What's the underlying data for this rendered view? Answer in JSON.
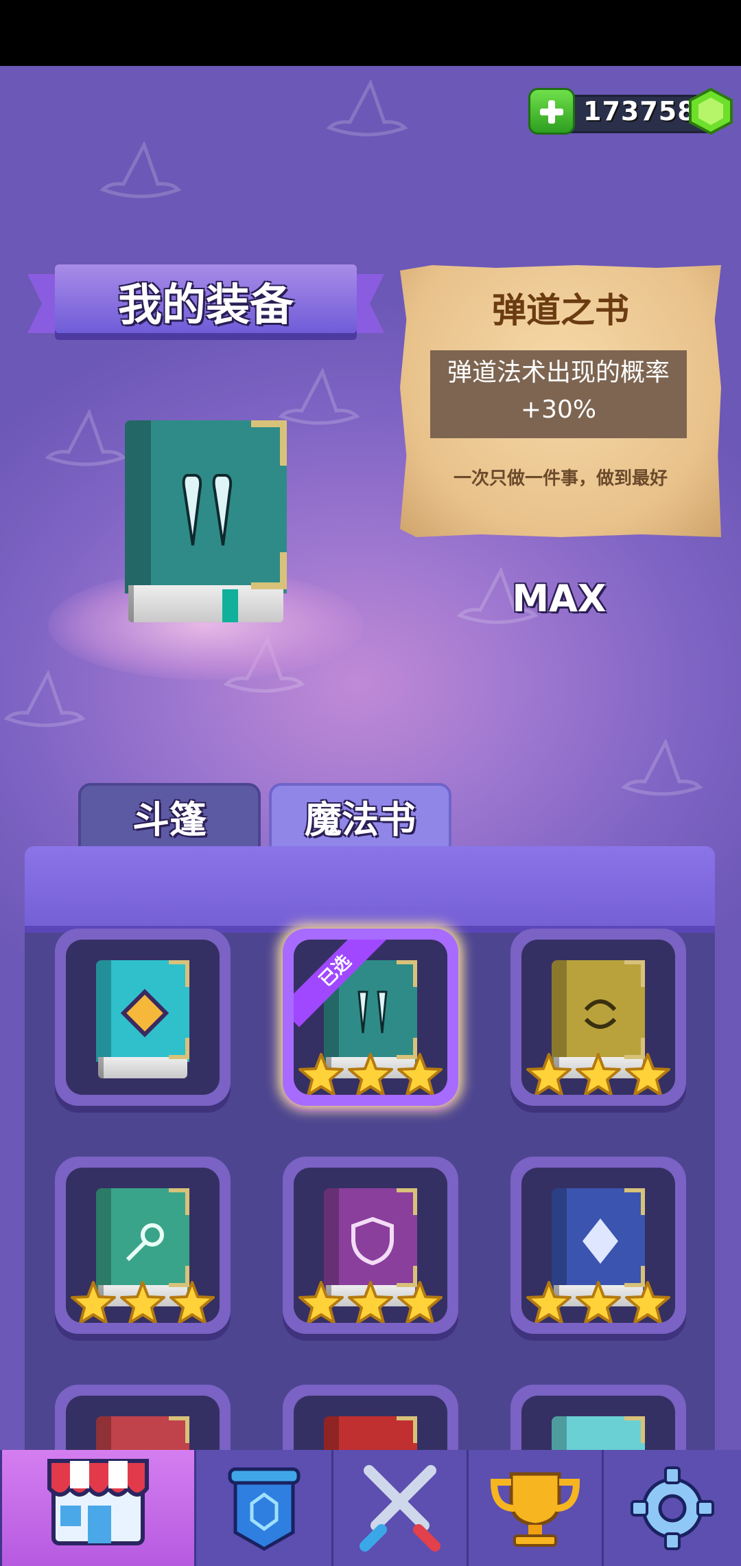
{
  "currency": {
    "amount": "173758",
    "plus_icon": "plus-icon",
    "gem_icon": "green-gem-icon"
  },
  "title": {
    "label": "我的装备"
  },
  "item_card": {
    "name": "弹道之书",
    "effect": "弹道法术出现的概率+30%",
    "motto": "一次只做一件事，做到最好"
  },
  "level_label": "MAX",
  "tabs": [
    {
      "label": "斗篷",
      "active": false
    },
    {
      "label": "魔法书",
      "active": true
    }
  ],
  "selected_badge": "已选",
  "books": [
    {
      "name": "diamond-book",
      "color": "#2fc0cc",
      "emblem": "diamond",
      "stars": 0,
      "selected": false
    },
    {
      "name": "ballistic-book",
      "color": "#2f8b88",
      "emblem": "fangs",
      "stars": 3,
      "selected": true
    },
    {
      "name": "bounce-book",
      "color": "#b9a23c",
      "emblem": "arrows",
      "stars": 3,
      "selected": false
    },
    {
      "name": "comet-book",
      "color": "#3aa48a",
      "emblem": "comet",
      "stars": 3,
      "selected": false
    },
    {
      "name": "shield-book",
      "color": "#8a3f9c",
      "emblem": "shield",
      "stars": 3,
      "selected": false
    },
    {
      "name": "crystal-book",
      "color": "#3a54b0",
      "emblem": "crystal",
      "stars": 3,
      "selected": false
    },
    {
      "name": "red-book-1",
      "color": "#c0424a",
      "emblem": "",
      "stars": 0,
      "selected": false
    },
    {
      "name": "red-book-2",
      "color": "#c03030",
      "emblem": "",
      "stars": 0,
      "selected": false
    },
    {
      "name": "cyan-book",
      "color": "#6ad0d4",
      "emblem": "",
      "stars": 0,
      "selected": false
    }
  ],
  "nav": [
    {
      "name": "shop",
      "icon": "shop-icon",
      "active": true
    },
    {
      "name": "equipment",
      "icon": "shield-banner-icon",
      "active": false
    },
    {
      "name": "battle",
      "icon": "crossed-swords-icon",
      "active": false
    },
    {
      "name": "rankings",
      "icon": "trophy-icon",
      "active": false
    },
    {
      "name": "settings",
      "icon": "gear-icon",
      "active": false
    }
  ]
}
